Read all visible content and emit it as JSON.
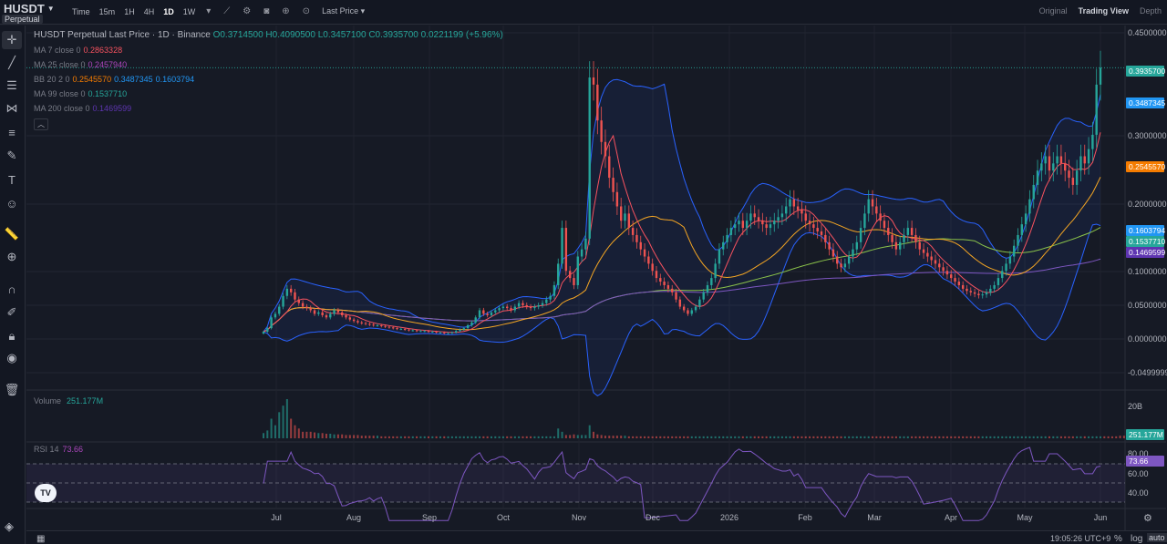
{
  "header": {
    "symbol": "HUSDT",
    "badge": "Perpetual",
    "intervals": [
      "Time",
      "15m",
      "1H",
      "4H",
      "1D",
      "1W"
    ],
    "active_interval": "1D",
    "price_source": "Last Price",
    "views": [
      "Original",
      "Trading View",
      "Depth"
    ],
    "active_view": "Trading View"
  },
  "legend": {
    "title": "HUSDT Perpetual Last Price · 1D · Binance",
    "open": "O0.3714500",
    "high": "H0.4090500",
    "low": "L0.3457100",
    "close": "C0.3935700",
    "change": "0.0221199 (+5.96%)",
    "ma7_label": "MA 7 close 0",
    "ma7_value": "0.2863328",
    "ma25_label": "MA 25 close 0",
    "ma25_value": "0.2457940",
    "bb_label": "BB 20 2 0",
    "bb_basis": "0.2545570",
    "bb_upper": "0.3487345",
    "bb_lower": "0.1603794",
    "ma99_label": "MA 99 close 0",
    "ma99_value": "0.1537710",
    "ma200_label": "MA 200 close 0",
    "ma200_value": "0.1469599",
    "volume_label": "Volume",
    "volume_value": "251.177M",
    "rsi_label": "RSI 14",
    "rsi_value": "73.66"
  },
  "price_axis": [
    "0.4500000",
    "0.3000000",
    "0.2000000",
    "0.1000000",
    "0.0500000",
    "0.0000000",
    "-0.0499999"
  ],
  "price_tags": [
    {
      "label": "0.3935700",
      "color": "#26a69a",
      "key": "last"
    },
    {
      "label": "0.3487345",
      "color": "#2196f3",
      "key": "bbup"
    },
    {
      "label": "0.2545570",
      "color": "#f57c00",
      "key": "bbmid"
    },
    {
      "label": "0.1603794",
      "color": "#2196f3",
      "key": "bblow"
    },
    {
      "label": "0.1537710",
      "color": "#26a69a",
      "key": "ma99"
    },
    {
      "label": "0.1469599",
      "color": "#5e35b1",
      "key": "ma200"
    }
  ],
  "volume_axis": [
    "20B"
  ],
  "volume_tag": "251.177M",
  "rsi_axis": [
    "80.00",
    "60.00",
    "40.00"
  ],
  "rsi_tag": "73.66",
  "time_axis": [
    "Jul",
    "Aug",
    "Sep",
    "Oct",
    "Nov",
    "Dec",
    "2026",
    "Feb",
    "Mar",
    "Apr",
    "May",
    "Jun"
  ],
  "footer": {
    "clock": "19:05:26 UTC+9",
    "percent": "%",
    "log": "log",
    "auto": "auto"
  },
  "tv_logo": "TV",
  "colors": {
    "up": "#26a69a",
    "down": "#ef5350",
    "ma7": "#f7525f",
    "ma25": "#f5a623",
    "bb": "#2962ff",
    "ma99": "#8bc34a",
    "ma200": "#7e57c2",
    "rsi": "#7e57c2"
  },
  "chart_data": {
    "type": "candlestick",
    "price_range": [
      -0.05,
      0.45
    ],
    "closes": [
      0.025,
      0.03,
      0.045,
      0.05,
      0.06,
      0.075,
      0.085,
      0.08,
      0.07,
      0.065,
      0.06,
      0.058,
      0.055,
      0.05,
      0.052,
      0.048,
      0.045,
      0.05,
      0.055,
      0.052,
      0.048,
      0.045,
      0.042,
      0.04,
      0.038,
      0.037,
      0.036,
      0.035,
      0.034,
      0.034,
      0.033,
      0.032,
      0.031,
      0.03,
      0.029,
      0.029,
      0.028,
      0.027,
      0.027,
      0.026,
      0.026,
      0.026,
      0.025,
      0.025,
      0.024,
      0.024,
      0.023,
      0.023,
      0.024,
      0.026,
      0.028,
      0.03,
      0.034,
      0.038,
      0.045,
      0.055,
      0.05,
      0.048,
      0.052,
      0.055,
      0.058,
      0.06,
      0.058,
      0.055,
      0.06,
      0.065,
      0.062,
      0.06,
      0.058,
      0.06,
      0.062,
      0.065,
      0.07,
      0.075,
      0.09,
      0.12,
      0.17,
      0.11,
      0.1,
      0.09,
      0.13,
      0.14,
      0.155,
      0.38,
      0.37,
      0.32,
      0.29,
      0.27,
      0.24,
      0.22,
      0.2,
      0.18,
      0.19,
      0.17,
      0.16,
      0.15,
      0.14,
      0.13,
      0.12,
      0.11,
      0.1,
      0.095,
      0.09,
      0.085,
      0.08,
      0.07,
      0.06,
      0.055,
      0.05,
      0.055,
      0.06,
      0.07,
      0.08,
      0.09,
      0.1,
      0.12,
      0.14,
      0.15,
      0.16,
      0.17,
      0.175,
      0.18,
      0.17,
      0.18,
      0.19,
      0.185,
      0.18,
      0.175,
      0.17,
      0.175,
      0.18,
      0.185,
      0.19,
      0.2,
      0.21,
      0.2,
      0.195,
      0.19,
      0.18,
      0.175,
      0.17,
      0.165,
      0.16,
      0.15,
      0.14,
      0.13,
      0.12,
      0.115,
      0.12,
      0.13,
      0.14,
      0.15,
      0.17,
      0.19,
      0.21,
      0.2,
      0.19,
      0.18,
      0.17,
      0.16,
      0.15,
      0.14,
      0.15,
      0.16,
      0.17,
      0.16,
      0.15,
      0.14,
      0.135,
      0.13,
      0.125,
      0.12,
      0.115,
      0.11,
      0.105,
      0.1,
      0.095,
      0.09,
      0.085,
      0.082,
      0.08,
      0.078,
      0.076,
      0.077,
      0.08,
      0.085,
      0.09,
      0.1,
      0.11,
      0.12,
      0.13,
      0.145,
      0.16,
      0.175,
      0.19,
      0.21,
      0.23,
      0.25,
      0.26,
      0.27,
      0.25,
      0.26,
      0.27,
      0.26,
      0.25,
      0.24,
      0.23,
      0.25,
      0.27,
      0.26,
      0.28,
      0.3,
      0.37,
      0.3936
    ],
    "volumes": [
      0.8,
      1.2,
      3,
      2,
      4,
      5,
      6,
      3,
      2,
      1.5,
      1,
      1,
      1,
      0.9,
      0.8,
      0.8,
      0.7,
      0.7,
      0.6,
      0.6,
      0.6,
      0.5,
      0.5,
      0.5,
      0.5,
      0.4,
      0.4,
      0.4,
      0.4,
      0.4,
      0.3,
      0.3,
      0.3,
      0.3,
      0.3,
      0.3,
      0.3,
      0.3,
      0.3,
      0.3,
      0.3,
      0.3,
      0.3,
      0.3,
      0.3,
      0.3,
      0.3,
      0.3,
      0.3,
      0.3,
      0.3,
      0.3,
      0.3,
      0.3,
      0.3,
      0.3,
      0.3,
      0.3,
      0.3,
      0.3,
      0.3,
      0.3,
      0.3,
      0.3,
      0.3,
      0.3,
      0.3,
      0.3,
      0.3,
      0.3,
      0.3,
      0.3,
      0.3,
      0.3,
      0.3,
      1.5,
      1,
      0.5,
      0.5,
      0.6,
      0.5,
      0.5,
      0.5,
      2,
      1,
      0.6,
      0.5,
      0.4,
      0.4,
      0.4,
      0.4,
      0.4,
      0.4,
      0.3,
      0.3,
      0.3,
      0.3,
      0.3,
      0.3,
      0.3,
      0.3,
      0.3,
      0.3,
      0.3,
      0.3,
      0.3,
      0.3,
      0.3,
      0.3,
      0.3,
      0.3,
      0.3,
      0.3,
      0.3,
      0.3,
      0.3,
      0.3,
      0.3,
      0.3,
      0.3,
      0.3,
      0.3,
      0.3,
      0.3,
      0.3,
      0.3,
      0.3,
      0.3,
      0.3,
      0.3,
      0.3,
      0.3,
      0.3,
      0.3,
      0.3,
      0.3,
      0.3,
      0.3,
      0.3,
      0.3,
      0.3,
      0.3,
      0.3,
      0.3,
      0.3,
      0.3,
      0.3,
      0.3,
      0.3,
      0.3,
      0.3,
      0.3,
      0.3,
      0.3,
      0.3,
      0.3,
      0.3,
      0.3,
      0.3,
      0.3,
      0.3,
      0.3,
      0.3,
      0.3,
      0.3,
      0.3,
      0.3,
      0.3,
      0.3,
      0.3,
      0.3,
      0.3,
      0.3,
      0.3,
      0.3,
      0.3,
      0.3,
      0.3,
      0.3,
      0.3,
      0.3,
      0.3,
      0.3,
      0.3,
      0.3,
      0.3,
      0.3,
      0.3,
      0.3,
      0.3,
      0.3,
      0.3,
      0.3,
      0.3,
      0.3,
      0.3,
      0.3,
      0.3,
      0.3,
      0.3,
      0.3,
      0.3,
      0.3,
      0.3,
      0.3,
      0.3,
      0.3,
      0.3,
      0.3,
      0.3,
      0.3,
      0.3,
      0.3,
      0.3,
      0.3,
      0.3,
      0.3,
      0.3,
      0.4,
      0.4,
      0.5,
      0.3
    ]
  }
}
